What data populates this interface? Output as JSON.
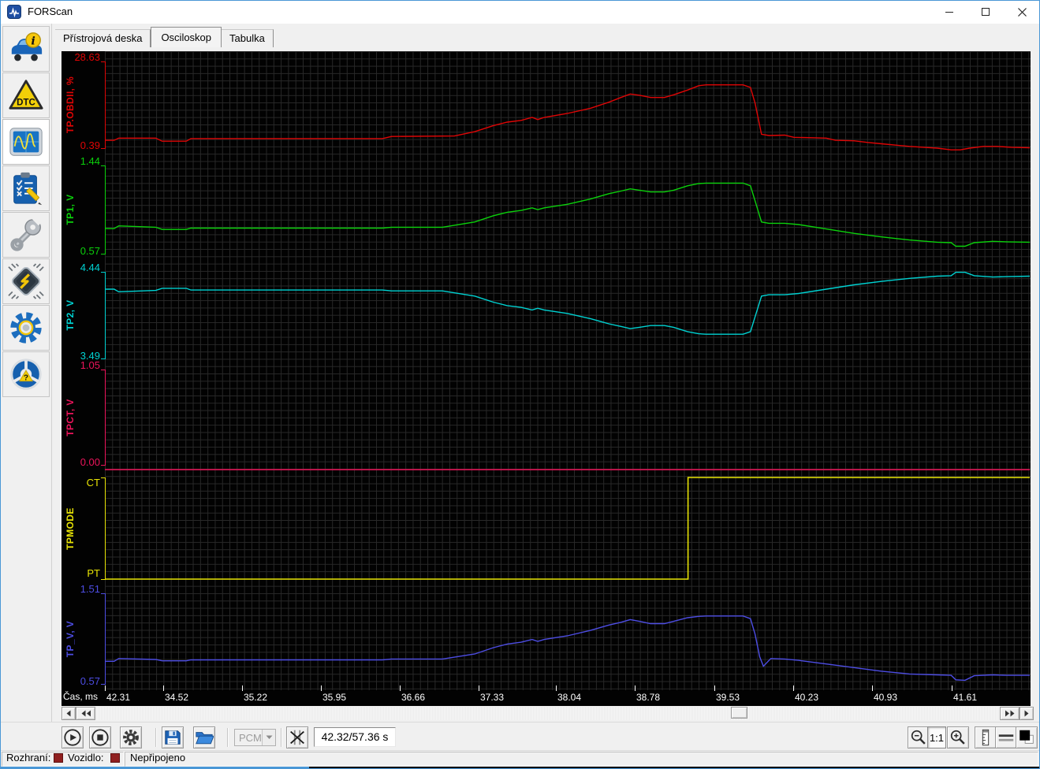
{
  "window": {
    "title": "FORScan"
  },
  "tabs": [
    {
      "key": "dashboard",
      "label": "Přístrojová deska",
      "active": false
    },
    {
      "key": "oscilloscope",
      "label": "Osciloskop",
      "active": true
    },
    {
      "key": "table",
      "label": "Tabulka",
      "active": false
    }
  ],
  "sidebar": {
    "dtc_label": "DTC",
    "help_glyph": "?",
    "info_glyph": "i",
    "items": [
      "vehicle-info",
      "dtc",
      "oscilloscope",
      "tests",
      "service-functions",
      "configuration",
      "settings",
      "help"
    ],
    "active_item": "oscilloscope"
  },
  "scope": {
    "background": "#020202",
    "grid_color": "#282828",
    "x_axis": {
      "label": "Čas, ms",
      "ticks": [
        "42.31",
        "34.52",
        "35.22",
        "35.95",
        "36.66",
        "37.33",
        "38.04",
        "38.78",
        "39.53",
        "40.23",
        "40.93",
        "41.61"
      ]
    },
    "panels": [
      {
        "name": "TP.OBDII, %",
        "color": "#e00505",
        "max": "28.63",
        "min": "0.39",
        "points": [
          [
            0,
            0.09
          ],
          [
            0.01,
            0.09
          ],
          [
            0.015,
            0.115
          ],
          [
            0.055,
            0.115
          ],
          [
            0.062,
            0.08
          ],
          [
            0.088,
            0.08
          ],
          [
            0.093,
            0.11
          ],
          [
            0.3,
            0.11
          ],
          [
            0.31,
            0.135
          ],
          [
            0.378,
            0.14
          ],
          [
            0.4,
            0.19
          ],
          [
            0.42,
            0.26
          ],
          [
            0.435,
            0.3
          ],
          [
            0.45,
            0.32
          ],
          [
            0.462,
            0.355
          ],
          [
            0.468,
            0.33
          ],
          [
            0.475,
            0.355
          ],
          [
            0.5,
            0.4
          ],
          [
            0.525,
            0.46
          ],
          [
            0.545,
            0.53
          ],
          [
            0.558,
            0.585
          ],
          [
            0.568,
            0.625
          ],
          [
            0.578,
            0.61
          ],
          [
            0.59,
            0.585
          ],
          [
            0.605,
            0.585
          ],
          [
            0.615,
            0.615
          ],
          [
            0.63,
            0.67
          ],
          [
            0.642,
            0.72
          ],
          [
            0.65,
            0.73
          ],
          [
            0.69,
            0.73
          ],
          [
            0.698,
            0.7
          ],
          [
            0.703,
            0.52
          ],
          [
            0.71,
            0.16
          ],
          [
            0.718,
            0.145
          ],
          [
            0.735,
            0.15
          ],
          [
            0.745,
            0.125
          ],
          [
            0.765,
            0.12
          ],
          [
            0.78,
            0.115
          ],
          [
            0.79,
            0.09
          ],
          [
            0.81,
            0.085
          ],
          [
            0.825,
            0.065
          ],
          [
            0.84,
            0.05
          ],
          [
            0.855,
            0.035
          ],
          [
            0.87,
            0.02
          ],
          [
            0.885,
            0.01
          ],
          [
            0.9,
            0
          ],
          [
            0.915,
            -0.02
          ],
          [
            0.925,
            -0.02
          ],
          [
            0.935,
            0
          ],
          [
            0.95,
            0.02
          ],
          [
            0.965,
            0.02
          ],
          [
            0.98,
            0.01
          ],
          [
            1,
            0.005
          ]
        ]
      },
      {
        "name": "TP1, V",
        "color": "#0bd10b",
        "max": "1.44",
        "min": "0.57",
        "points": [
          [
            0,
            0.285
          ],
          [
            0.01,
            0.285
          ],
          [
            0.015,
            0.315
          ],
          [
            0.055,
            0.3
          ],
          [
            0.062,
            0.275
          ],
          [
            0.088,
            0.275
          ],
          [
            0.093,
            0.29
          ],
          [
            0.3,
            0.29
          ],
          [
            0.31,
            0.3
          ],
          [
            0.365,
            0.3
          ],
          [
            0.4,
            0.36
          ],
          [
            0.42,
            0.43
          ],
          [
            0.435,
            0.47
          ],
          [
            0.45,
            0.49
          ],
          [
            0.462,
            0.52
          ],
          [
            0.468,
            0.5
          ],
          [
            0.475,
            0.52
          ],
          [
            0.5,
            0.56
          ],
          [
            0.525,
            0.62
          ],
          [
            0.545,
            0.68
          ],
          [
            0.558,
            0.71
          ],
          [
            0.568,
            0.735
          ],
          [
            0.578,
            0.72
          ],
          [
            0.59,
            0.7
          ],
          [
            0.605,
            0.7
          ],
          [
            0.615,
            0.72
          ],
          [
            0.63,
            0.77
          ],
          [
            0.642,
            0.795
          ],
          [
            0.65,
            0.8
          ],
          [
            0.69,
            0.8
          ],
          [
            0.698,
            0.77
          ],
          [
            0.703,
            0.6
          ],
          [
            0.71,
            0.36
          ],
          [
            0.718,
            0.345
          ],
          [
            0.735,
            0.345
          ],
          [
            0.75,
            0.33
          ],
          [
            0.78,
            0.28
          ],
          [
            0.81,
            0.23
          ],
          [
            0.84,
            0.19
          ],
          [
            0.87,
            0.155
          ],
          [
            0.9,
            0.13
          ],
          [
            0.915,
            0.125
          ],
          [
            0.92,
            0.085
          ],
          [
            0.93,
            0.085
          ],
          [
            0.94,
            0.125
          ],
          [
            0.96,
            0.14
          ],
          [
            0.975,
            0.135
          ],
          [
            1,
            0.13
          ]
        ]
      },
      {
        "name": "TP2, V",
        "color": "#00d2d2",
        "max": "4.44",
        "min": "3.49",
        "points": [
          [
            0,
            0.8
          ],
          [
            0.01,
            0.8
          ],
          [
            0.015,
            0.77
          ],
          [
            0.055,
            0.785
          ],
          [
            0.062,
            0.81
          ],
          [
            0.088,
            0.81
          ],
          [
            0.093,
            0.79
          ],
          [
            0.3,
            0.79
          ],
          [
            0.31,
            0.78
          ],
          [
            0.365,
            0.78
          ],
          [
            0.4,
            0.72
          ],
          [
            0.42,
            0.65
          ],
          [
            0.435,
            0.61
          ],
          [
            0.45,
            0.59
          ],
          [
            0.462,
            0.56
          ],
          [
            0.468,
            0.58
          ],
          [
            0.475,
            0.56
          ],
          [
            0.5,
            0.52
          ],
          [
            0.525,
            0.46
          ],
          [
            0.545,
            0.4
          ],
          [
            0.558,
            0.37
          ],
          [
            0.568,
            0.345
          ],
          [
            0.578,
            0.36
          ],
          [
            0.59,
            0.38
          ],
          [
            0.605,
            0.38
          ],
          [
            0.615,
            0.36
          ],
          [
            0.63,
            0.31
          ],
          [
            0.642,
            0.285
          ],
          [
            0.65,
            0.28
          ],
          [
            0.69,
            0.28
          ],
          [
            0.698,
            0.31
          ],
          [
            0.703,
            0.48
          ],
          [
            0.71,
            0.72
          ],
          [
            0.718,
            0.735
          ],
          [
            0.735,
            0.735
          ],
          [
            0.75,
            0.75
          ],
          [
            0.78,
            0.8
          ],
          [
            0.81,
            0.85
          ],
          [
            0.84,
            0.89
          ],
          [
            0.87,
            0.925
          ],
          [
            0.9,
            0.95
          ],
          [
            0.915,
            0.955
          ],
          [
            0.92,
            0.995
          ],
          [
            0.93,
            0.995
          ],
          [
            0.94,
            0.955
          ],
          [
            0.96,
            0.94
          ],
          [
            0.975,
            0.945
          ],
          [
            1,
            0.95
          ]
        ]
      },
      {
        "name": "TPCT, V",
        "color": "#ed145b",
        "max": "1.05",
        "min": "0.00",
        "points": [
          [
            0,
            0
          ],
          [
            1,
            0
          ]
        ]
      },
      {
        "name": "TPMODE",
        "color": "#e8e405",
        "max": "CT",
        "min": "PT",
        "inset_labels": true,
        "points": [
          [
            0,
            0
          ],
          [
            0.6305,
            0
          ],
          [
            0.6305,
            1
          ],
          [
            1,
            1
          ]
        ]
      },
      {
        "name": "TP_V, V",
        "color": "#4d4de4",
        "max": "1.51",
        "min": "0.57",
        "points": [
          [
            0,
            0.25
          ],
          [
            0.01,
            0.25
          ],
          [
            0.015,
            0.28
          ],
          [
            0.055,
            0.27
          ],
          [
            0.062,
            0.255
          ],
          [
            0.088,
            0.255
          ],
          [
            0.093,
            0.265
          ],
          [
            0.3,
            0.265
          ],
          [
            0.31,
            0.275
          ],
          [
            0.365,
            0.275
          ],
          [
            0.4,
            0.33
          ],
          [
            0.42,
            0.4
          ],
          [
            0.435,
            0.44
          ],
          [
            0.45,
            0.46
          ],
          [
            0.462,
            0.49
          ],
          [
            0.468,
            0.47
          ],
          [
            0.475,
            0.49
          ],
          [
            0.5,
            0.53
          ],
          [
            0.525,
            0.59
          ],
          [
            0.545,
            0.65
          ],
          [
            0.558,
            0.68
          ],
          [
            0.568,
            0.71
          ],
          [
            0.578,
            0.69
          ],
          [
            0.59,
            0.665
          ],
          [
            0.605,
            0.665
          ],
          [
            0.615,
            0.69
          ],
          [
            0.63,
            0.73
          ],
          [
            0.642,
            0.745
          ],
          [
            0.65,
            0.75
          ],
          [
            0.69,
            0.75
          ],
          [
            0.698,
            0.72
          ],
          [
            0.703,
            0.55
          ],
          [
            0.708,
            0.3
          ],
          [
            0.712,
            0.195
          ],
          [
            0.72,
            0.28
          ],
          [
            0.735,
            0.275
          ],
          [
            0.75,
            0.26
          ],
          [
            0.78,
            0.22
          ],
          [
            0.81,
            0.18
          ],
          [
            0.84,
            0.14
          ],
          [
            0.87,
            0.11
          ],
          [
            0.9,
            0.1
          ],
          [
            0.915,
            0.095
          ],
          [
            0.92,
            0.045
          ],
          [
            0.93,
            0.04
          ],
          [
            0.94,
            0.09
          ],
          [
            0.96,
            0.1
          ],
          [
            0.975,
            0.095
          ],
          [
            1,
            0.095
          ]
        ]
      }
    ]
  },
  "toolbar": {
    "pcm_label": "PCM",
    "time_display": "42.32/57.36 s",
    "zoom_ratio_label": "1:1"
  },
  "status_bar": {
    "interface_label": "Rozhraní:",
    "vehicle_label": "Vozidlo:",
    "status_text": "Nepřipojeno",
    "indicator_color": "#8f1f1f"
  }
}
